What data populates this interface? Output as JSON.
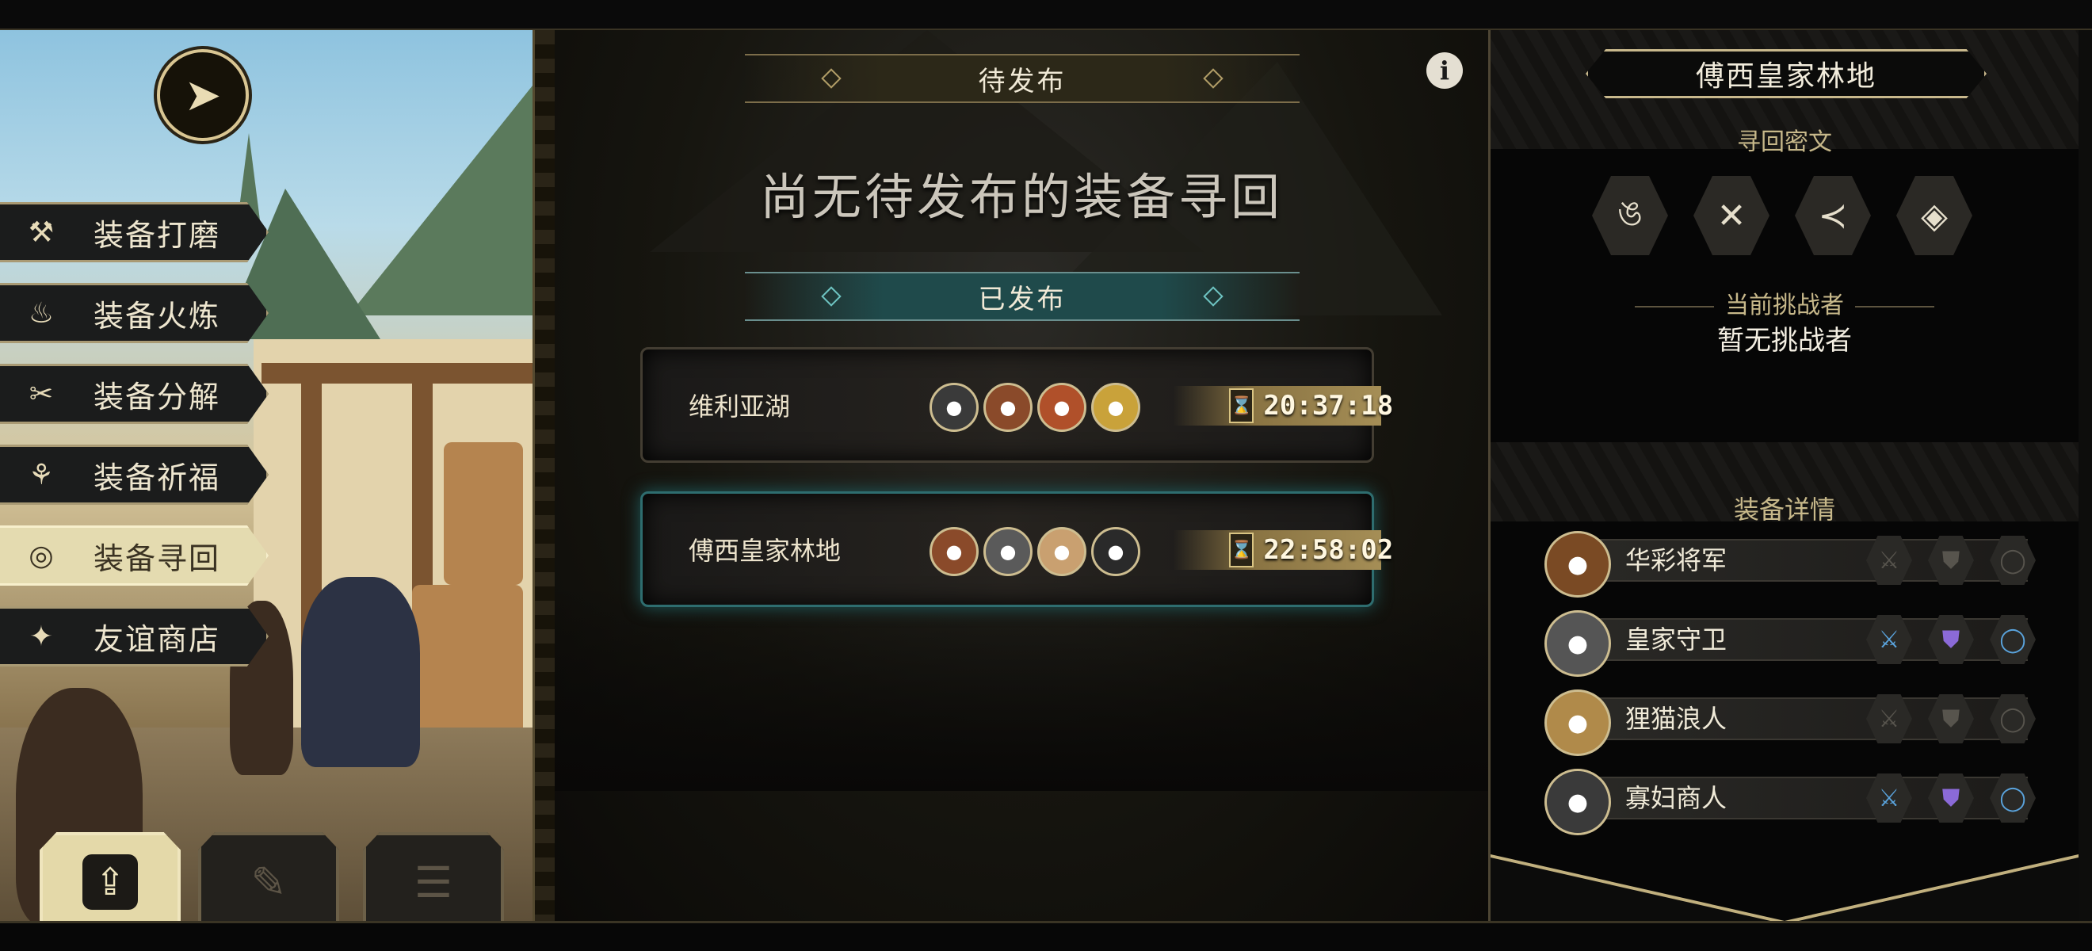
{
  "left_menu": {
    "items": [
      {
        "label": "装备打磨",
        "icon": "hammer-icon",
        "glyph": "⚒",
        "active": false
      },
      {
        "label": "装备火炼",
        "icon": "flame-icon",
        "glyph": "♨",
        "active": false
      },
      {
        "label": "装备分解",
        "icon": "break-icon",
        "glyph": "✂",
        "active": false
      },
      {
        "label": "装备祈福",
        "icon": "blessing-icon",
        "glyph": "⚘",
        "active": false
      },
      {
        "label": "装备寻回",
        "icon": "target-icon",
        "glyph": "◎",
        "active": true
      },
      {
        "label": "友谊商店",
        "icon": "fox-icon",
        "glyph": "✦",
        "active": false
      }
    ]
  },
  "bottom_buttons": [
    {
      "icon": "upload-icon",
      "glyph": "⇪",
      "active": true
    },
    {
      "icon": "feather-icon",
      "glyph": "✎",
      "active": false
    },
    {
      "icon": "list-icon",
      "glyph": "☰",
      "active": false
    }
  ],
  "middle": {
    "pending_label": "待发布",
    "empty_message": "尚无待发布的装备寻回",
    "published_label": "已发布",
    "quests": [
      {
        "name": "维利亚湖",
        "time": "20:37:18",
        "avatars": [
          "#3a3a3a",
          "#8a4a2a",
          "#b0502a",
          "#c9a23a"
        ],
        "selected": false
      },
      {
        "name": "傅西皇家林地",
        "time": "22:58:02",
        "avatars": [
          "#8a4a2a",
          "#5a5a5a",
          "#c9a070",
          "#2a2a2a"
        ],
        "selected": true
      }
    ]
  },
  "right_panel": {
    "title": "傅西皇家林地",
    "runes_label": "寻回密文",
    "runes": [
      "ঙ",
      "✕",
      "≺",
      "◈"
    ],
    "challenger_label": "当前挑战者",
    "challenger_value": "暂无挑战者",
    "equipment_label": "装备详情",
    "equipment": [
      {
        "name": "华彩将军",
        "avatar": "#7a4a24",
        "weapon": false,
        "armor": false,
        "ring": false
      },
      {
        "name": "皇家守卫",
        "avatar": "#555555",
        "weapon": true,
        "armor": true,
        "ring": true
      },
      {
        "name": "狸猫浪人",
        "avatar": "#b08a4a",
        "weapon": false,
        "armor": false,
        "ring": false
      },
      {
        "name": "寡妇商人",
        "avatar": "#3a3a3a",
        "weapon": true,
        "armor": true,
        "ring": true
      }
    ]
  },
  "colors": {
    "accent_gold": "#c8b88c",
    "accent_teal": "#2e6d6f",
    "slot_weapon": "#5aa3dc",
    "slot_armor": "#8b6ad8"
  }
}
